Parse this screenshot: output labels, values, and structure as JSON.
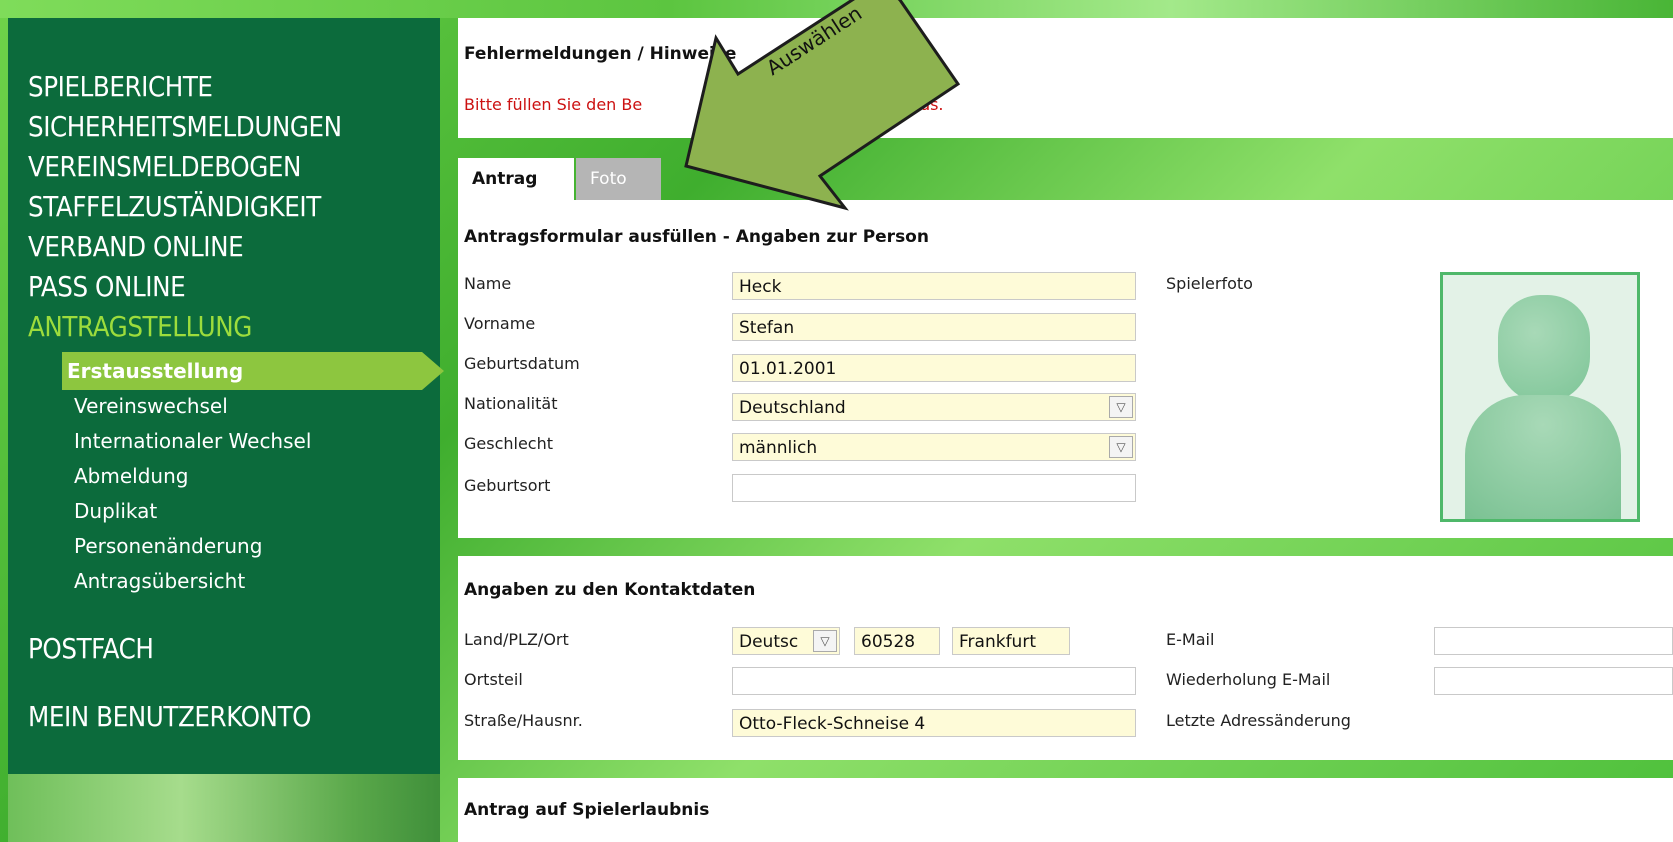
{
  "sidebar": {
    "main_items": [
      {
        "label": "SPIELBERICHTE"
      },
      {
        "label": "SICHERHEITSMELDUNGEN"
      },
      {
        "label": "VEREINSMELDEBOGEN"
      },
      {
        "label": "STAFFELZUSTÄNDIGKEIT"
      },
      {
        "label": "VERBAND ONLINE"
      },
      {
        "label": "PASS ONLINE"
      },
      {
        "label": "ANTRAGSTELLUNG"
      },
      {
        "label": "POSTFACH"
      },
      {
        "label": "MEIN BENUTZERKONTO"
      }
    ],
    "sub_items": [
      {
        "label": "Erstausstellung"
      },
      {
        "label": "Vereinswechsel"
      },
      {
        "label": "Internationaler Wechsel"
      },
      {
        "label": "Abmeldung"
      },
      {
        "label": "Duplikat"
      },
      {
        "label": "Personenänderung"
      },
      {
        "label": "Antragsübersicht"
      }
    ]
  },
  "messages": {
    "title": "Fehlermeldungen / Hinweise",
    "error_text": "Bitte füllen Sie den Be",
    "error_text_end": "ung des Vereins\" aus."
  },
  "annotation": {
    "text": "Auswählen",
    "arrow_color": "#8db24f"
  },
  "tabs": [
    {
      "label": "Antrag"
    },
    {
      "label": "Foto"
    }
  ],
  "person": {
    "title": "Antragsformular ausfüllen - Angaben zur Person",
    "fields": [
      {
        "label": "Name",
        "value": "Heck"
      },
      {
        "label": "Vorname",
        "value": "Stefan"
      },
      {
        "label": "Geburtsdatum",
        "value": "01.01.2001"
      },
      {
        "label": "Nationalität",
        "value": "Deutschland"
      },
      {
        "label": "Geschlecht",
        "value": "männlich"
      },
      {
        "label": "Geburtsort",
        "value": ""
      }
    ],
    "photo_label": "Spielerfoto"
  },
  "contact": {
    "title": "Angaben zu den Kontaktdaten",
    "land_label": "Land/PLZ/Ort",
    "land_value": "Deutsc",
    "plz_value": "60528",
    "ort_value": "Frankfurt",
    "ortsteil_label": "Ortsteil",
    "ortsteil_value": "",
    "street_label": "Straße/Hausnr.",
    "street_value": "Otto-Fleck-Schneise 4",
    "email_label": "E-Mail",
    "email_repeat_label": "Wiederholung E-Mail",
    "address_change_label": "Letzte Adressänderung"
  },
  "permit": {
    "title": "Antrag auf Spielerlaubnis"
  },
  "icons": {
    "dropdown": "▽"
  }
}
